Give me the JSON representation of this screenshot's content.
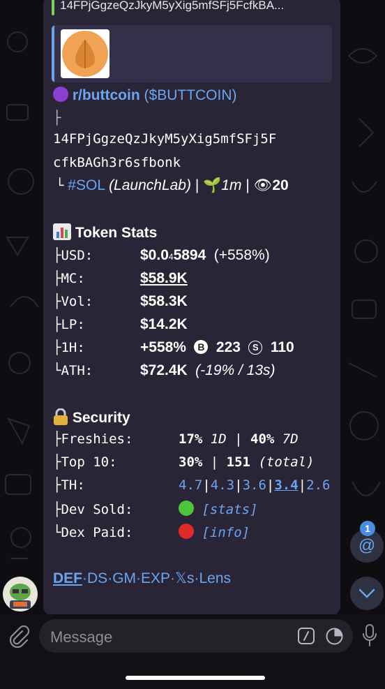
{
  "reply": {
    "text": "14FPjGgzeQzJkyM5yXig5mfSFj5FcfkBA..."
  },
  "token": {
    "name": "r/buttcoin",
    "ticker": "($BUTTCOIN)",
    "tree_top": "├",
    "address_line1": "14FPjGgzeQzJkyM5yXig5mfSFj5F",
    "address_line2": "cfkBAGh3r6sfbonk",
    "chain": "#SOL",
    "platform": "(LaunchLab)",
    "sep": "|",
    "age": "1m",
    "views": "20"
  },
  "stats": {
    "title": "Token Stats",
    "usd_label": "├USD:",
    "usd_value": "$0.0",
    "usd_sub": "4",
    "usd_value2": "5894",
    "usd_change": "(+558%)",
    "mc_label": "├MC:",
    "mc_value": "$58.9K",
    "vol_label": "├Vol:",
    "vol_value": "$58.3K",
    "lp_label": "├LP:",
    "lp_value": "$14.2K",
    "h1_label": "├1H:",
    "h1_value": "+558%",
    "h1_buys": "223",
    "h1_sells": "110",
    "ath_label": "└ATH:",
    "ath_value": "$72.4K",
    "ath_note": "(-19% / 13s)"
  },
  "security": {
    "title": "Security",
    "freshies_label": "├Freshies:",
    "freshies_1d": "17%",
    "freshies_1d_unit": "1D",
    "freshies_7d": "40%",
    "freshies_7d_unit": "7D",
    "top10_label": "├Top 10:",
    "top10_value": "30%",
    "top10_count": "151",
    "top10_note": "(total)",
    "th_label": "├TH:",
    "th_values": [
      "4.7",
      "4.3",
      "3.6",
      "3.4",
      "2.6"
    ],
    "dev_label": "├Dev Sold:",
    "dev_link": "[stats]",
    "dex_label": "└Dex Paid:",
    "dex_link": "[info]"
  },
  "links": [
    "DEF",
    "DS",
    "GM",
    "EXP",
    "𝕏s",
    "Lens"
  ],
  "link_sep": "·",
  "input": {
    "placeholder": "Message"
  },
  "mentions_badge": "1",
  "colors": {
    "accent": "#6aa5f0",
    "bubble": "#2a2536",
    "green": "#4cc53a",
    "red": "#e02a2a"
  }
}
